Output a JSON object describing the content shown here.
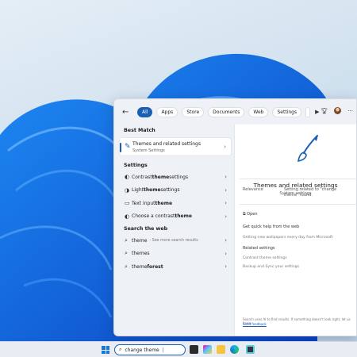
{
  "colors": {
    "accent": "#1a5fb4",
    "panel": "#eef1f6",
    "taskbar": "#e8edf3"
  },
  "topbar": {
    "back_icon": "back-arrow-icon",
    "filters": [
      "All",
      "Apps",
      "Store",
      "Documents",
      "Web",
      "Settings"
    ],
    "active_filter": "All",
    "more_icon": "play-icon"
  },
  "left": {
    "best_match_header": "Best Match",
    "best": {
      "title": "Themes and related settings",
      "subtitle": "System Settings"
    },
    "settings_header": "Settings",
    "settings": [
      {
        "icon": "contrast-icon",
        "pre": "Contrast ",
        "bold": "theme",
        "post": " settings"
      },
      {
        "icon": "theme-icon",
        "pre": "Light ",
        "bold": "theme",
        "post": " settings"
      },
      {
        "icon": "text-input-icon",
        "pre": "Text input ",
        "bold": "theme",
        "post": ""
      },
      {
        "icon": "contrast-icon",
        "pre": "Choose a contrast ",
        "bold": "theme",
        "post": ""
      }
    ],
    "web_header": "Search the web",
    "web": [
      {
        "pre": "theme",
        "bold": "",
        "sub": " - See more search results"
      },
      {
        "pre": "themes",
        "bold": "",
        "sub": ""
      },
      {
        "pre": "theme",
        "bold": "forest",
        "sub": ""
      }
    ]
  },
  "right": {
    "title": "Themes and related settings",
    "subtitle": "System settings",
    "relevance_label": "Relevance",
    "relevance_value": "Setting related to \"change theme\" found.",
    "open": "Open",
    "quick_help": "Get quick help from the web",
    "wallpapers": "Getting new wallpapers every day from Microsoft",
    "related_header": "Related settings",
    "related": [
      "Contrast theme settings",
      "Backup and Sync your settings"
    ],
    "footer": "Search uses AI to find results. If something doesn't look right, let us know.",
    "feedback": "Send feedback"
  },
  "taskbar": {
    "search_value": "change theme"
  }
}
